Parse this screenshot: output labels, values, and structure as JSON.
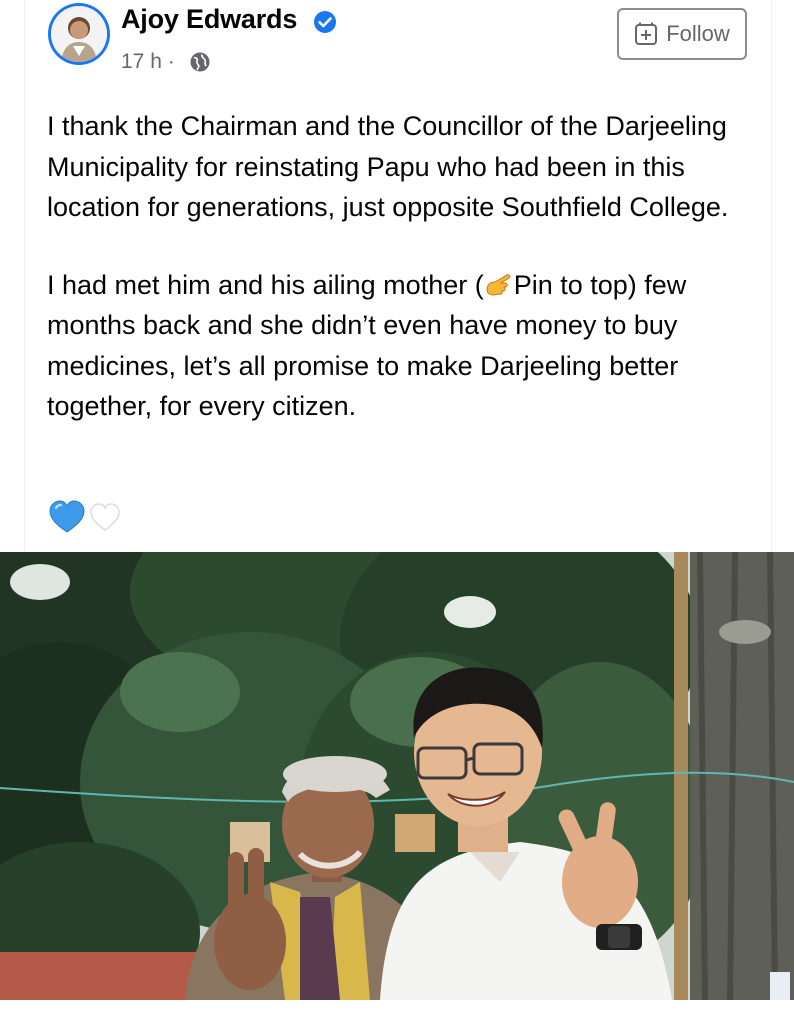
{
  "post": {
    "author": "Ajoy Edwards",
    "timestamp": "17 h · ",
    "follow_label": "Follow",
    "paragraph_1": "I thank the Chairman and the Councillor of the Darjeeling Municipality for reinstating Papu who had been in this location for generations, just opposite Southfield College.",
    "paragraph_2_before": "I had met him and his ailing mother (",
    "paragraph_2_after": "Pin to top) few months back and she didn’t even have money to buy medicines, let’s all promise to make Darjeeling better together, for every citizen."
  },
  "icons": {
    "verified": "verified-badge-icon",
    "privacy": "globe-icon",
    "follow": "follow-plus-icon",
    "emoji": "pointing-hand-emoji",
    "reactions": [
      "blue-heart-emoji",
      "white-heart-emoji"
    ]
  },
  "colors": {
    "accent": "#1877f2",
    "secondary_text": "#65676b",
    "primary_text": "#050505"
  }
}
